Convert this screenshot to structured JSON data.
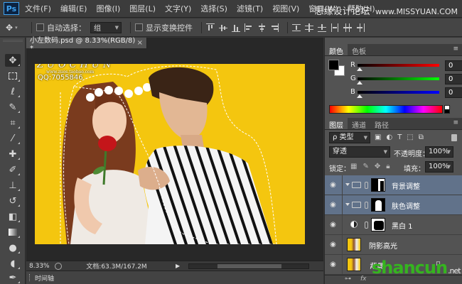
{
  "app": {
    "logo": "Ps"
  },
  "menu": {
    "items": [
      "文件(F)",
      "编辑(E)",
      "图像(I)",
      "图层(L)",
      "文字(Y)",
      "选择(S)",
      "滤镜(T)",
      "视图(V)",
      "窗口(W)",
      "帮助(H)"
    ],
    "watermark_big": "思缘设计论坛",
    "watermark_small": "www.MISSYUAN.COM"
  },
  "options": {
    "auto_select_label": "自动选择：",
    "auto_select_value": "组",
    "show_transform_label": "显示变换控件"
  },
  "document": {
    "tab_title": "小左数码.psd @ 8.33%(RGB/8) *",
    "tab_close": "×",
    "zoom": "8.33%",
    "doc_size": "文档:63.3M/167.2M",
    "timeline_label": "时间轴"
  },
  "photo": {
    "brand": "ZUOCHUN",
    "url": "www.zuos.taobao.com",
    "qq": "QQ:7055846"
  },
  "color_panel": {
    "tabs": [
      "颜色",
      "色板"
    ],
    "channels": [
      {
        "label": "R",
        "value": "0",
        "color": "#ff0000"
      },
      {
        "label": "G",
        "value": "0",
        "color": "#00ff00"
      },
      {
        "label": "B",
        "value": "0",
        "color": "#0000ff"
      }
    ],
    "foreground": "#000000",
    "background": "#ffffff"
  },
  "layers_panel": {
    "tabs": [
      "图层",
      "通道",
      "路径"
    ],
    "filter_label": "ρ 类型",
    "blend_mode": "穿透",
    "opacity_label": "不透明度：",
    "opacity_value": "100%",
    "lock_label": "锁定：",
    "fill_label": "填充：",
    "fill_value": "100%",
    "layers": [
      {
        "name": "背景调整",
        "type": "group",
        "selected": true
      },
      {
        "name": "肤色调整",
        "type": "group",
        "selected": true
      },
      {
        "name": "黑白 1",
        "type": "adjustment",
        "selected": false
      },
      {
        "name": "阴影高光",
        "type": "pixel",
        "selected": false
      },
      {
        "name": "背景",
        "type": "background",
        "selected": false
      }
    ],
    "bottom_watermark": "shancun",
    "bottom_watermark_suffix": ".net"
  },
  "colors": {
    "canvas_yellow": "#f4c60f",
    "selection_blue": "#61728a"
  }
}
